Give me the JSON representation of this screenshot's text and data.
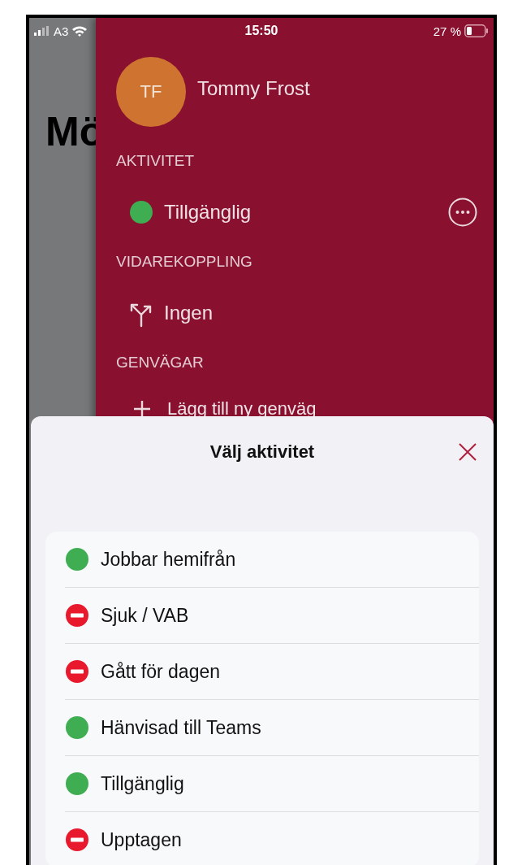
{
  "status_bar": {
    "carrier": "A3",
    "time": "15:50",
    "battery": "27 %"
  },
  "background_page": {
    "title": "Mö"
  },
  "drawer": {
    "user": {
      "initials": "TF",
      "name": "Tommy Frost"
    },
    "activity": {
      "heading": "AKTIVITET",
      "status": {
        "label": "Tillgänglig",
        "kind": "available"
      }
    },
    "forwarding": {
      "heading": "VIDAREKOPPLING",
      "value": "Ingen"
    },
    "shortcuts": {
      "heading": "GENVÄGAR",
      "add_label": "Lägg till ny genväg"
    }
  },
  "sheet": {
    "title": "Välj aktivitet",
    "options": [
      {
        "label": "Jobbar hemifrån",
        "kind": "available"
      },
      {
        "label": "Sjuk / VAB",
        "kind": "busy"
      },
      {
        "label": "Gått för dagen",
        "kind": "busy"
      },
      {
        "label": "Hänvisad till Teams",
        "kind": "available"
      },
      {
        "label": "Tillgänglig",
        "kind": "available"
      },
      {
        "label": "Upptagen",
        "kind": "busy"
      }
    ]
  }
}
